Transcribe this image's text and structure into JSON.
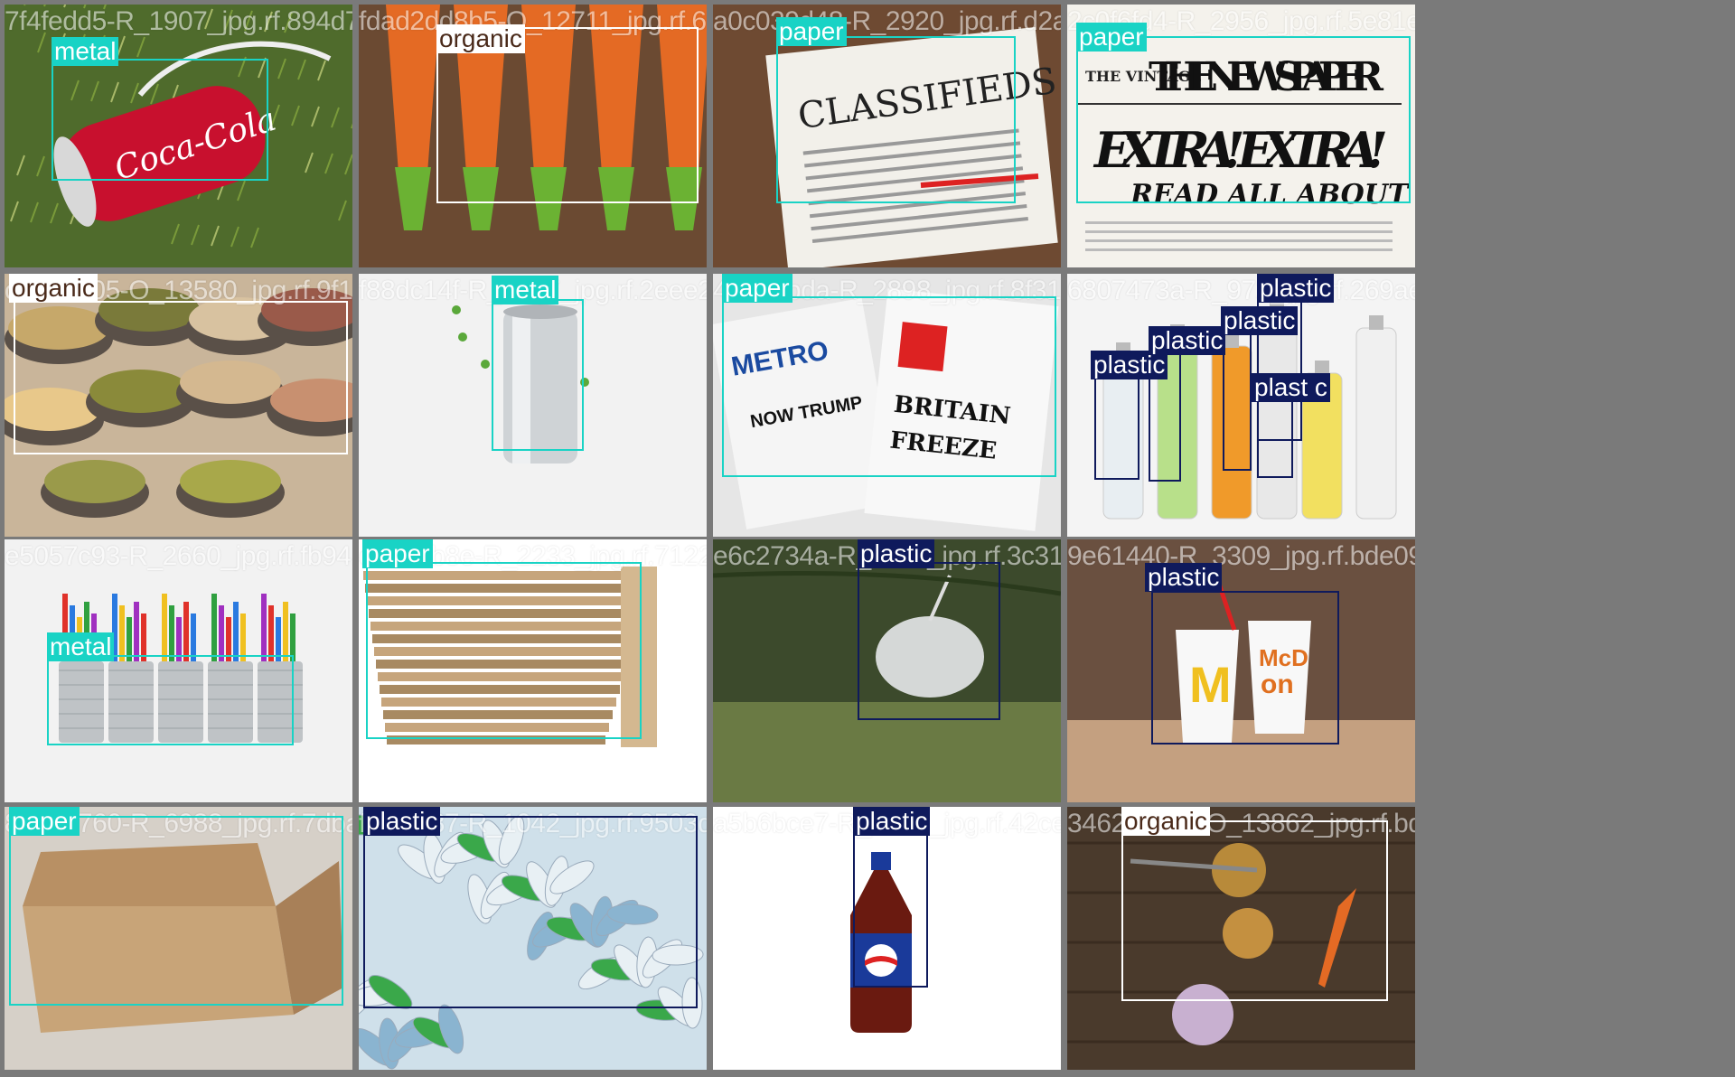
{
  "colors": {
    "metal": "#19d3c5",
    "paper": "#19d3c5",
    "organic": "#ffffff",
    "plastic": "#0f1a5c",
    "grid_background": "#7a7a7a"
  },
  "tiles": [
    {
      "filename": "7f4fedd5-R_1907_jpg.rf.894d73125f9a2d885",
      "scene": "coca-cola can on grass",
      "detections": [
        {
          "label": "metal"
        }
      ]
    },
    {
      "filename": "fdad2dd8b5-O_12711_jpg.rf.69c447a",
      "scene": "carrots",
      "detections": [
        {
          "label": "organic"
        }
      ]
    },
    {
      "filename": "a0c039d48-R_2920_jpg.rf.d2a5666",
      "scene": "classifieds newspaper",
      "detections": [
        {
          "label": "paper"
        }
      ]
    },
    {
      "filename": "2c0f6fd4-R_2956_jpg.rf.5e81eb",
      "scene": "vintage newspaper",
      "detections": [
        {
          "label": "paper"
        }
      ],
      "newspaper": {
        "masthead": "THE NEWSPAPER",
        "prefix": "THE VINTAGE",
        "headline": "EXTRA! EXTRA!",
        "sub": "READ ALL ABOUT IT"
      }
    },
    {
      "filename": "c6e2d505-O_13580_jpg.rf.9f18fa2c3d7a14c7",
      "scene": "bowls of grains",
      "detections": [
        {
          "label": "organic"
        }
      ]
    },
    {
      "filename": "f88dc14f-R_2447_jpg.rf.2eee23bf",
      "scene": "aluminum can",
      "detections": [
        {
          "label": "metal"
        }
      ]
    },
    {
      "filename": "4b1e0bda-R_2898_jpg.rf.8f317af7a",
      "scene": "stack of newspapers",
      "detections": [
        {
          "label": "paper"
        }
      ]
    },
    {
      "filename": "6807473a-R_972_jpg.rf.269ae0fb2",
      "scene": "plastic bottles",
      "detections": [
        {
          "label": "plastic"
        },
        {
          "label": "plastic"
        },
        {
          "label": "plastic"
        },
        {
          "label": "plastic"
        },
        {
          "label": "plast c"
        }
      ]
    },
    {
      "filename": "e5057c93-R_2660_jpg.rf.fb941cd22",
      "scene": "tin cans with pens",
      "detections": [
        {
          "label": "metal"
        }
      ]
    },
    {
      "filename": "e6c7ab8e-R_2233_jpg.rf.71226cd3a",
      "scene": "corrugated cardboard stack",
      "detections": [
        {
          "label": "paper"
        }
      ]
    },
    {
      "filename": "e6c2734a-R_3311_jpg.rf.3c313f22d7",
      "scene": "plastic bag on branch",
      "detections": [
        {
          "label": "plastic"
        }
      ]
    },
    {
      "filename": "9e61440-R_3309_jpg.rf.bde091b4",
      "scene": "mcdonald's cups",
      "detections": [
        {
          "label": "plastic"
        }
      ]
    },
    {
      "filename": "8a95e760-R_6988_jpg.rf.7dba0adf",
      "scene": "open cardboard box",
      "detections": [
        {
          "label": "paper"
        }
      ]
    },
    {
      "filename": "f1f6c187-R_1042_jpg.rf.9503d24",
      "scene": "pile of plastic bottles",
      "detections": [
        {
          "label": "plastic"
        }
      ]
    },
    {
      "filename": "a5b6bce7-R_1777_jpg.rf.42ce61399162",
      "scene": "pepsi bottle",
      "detections": [
        {
          "label": "plastic"
        }
      ]
    },
    {
      "filename": "3462a0ca5-O_13862_jpg.rf.bd35616",
      "scene": "vegetables on wood",
      "detections": [
        {
          "label": "organic"
        }
      ]
    }
  ]
}
